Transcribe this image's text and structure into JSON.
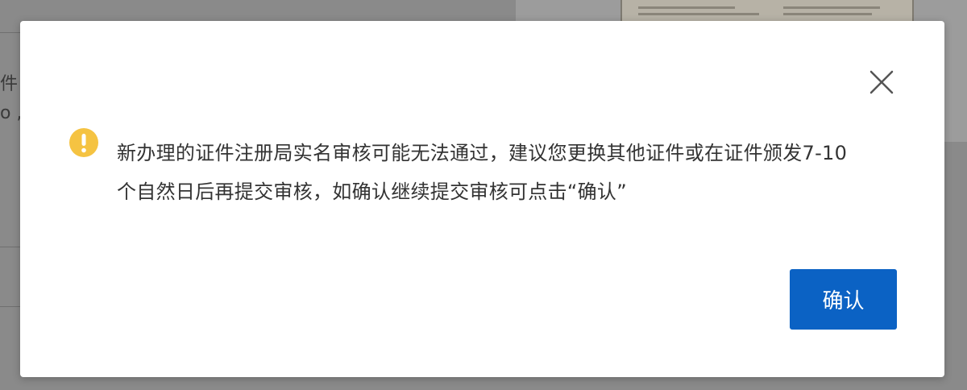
{
  "background": {
    "fragment_1": "件",
    "fragment_2": "o ,"
  },
  "dialog": {
    "message": "新办理的证件注册局实名审核可能无法通过，建议您更换其他证件或在证件颁发7-10个自然日后再提交审核，如确认继续提交审核可点击“确认”",
    "confirm_label": "确认",
    "icon_warning": "warning-circle-icon",
    "icon_close": "close-icon",
    "colors": {
      "warning": "#f5c342",
      "primary": "#0b62c4",
      "text": "#333333"
    }
  }
}
